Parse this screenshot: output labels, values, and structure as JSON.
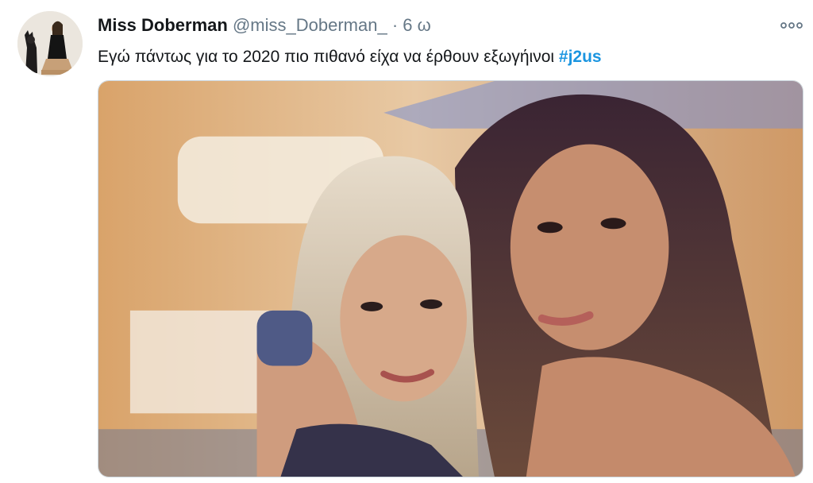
{
  "tweet": {
    "display_name": "Miss Doberman",
    "handle": "@miss_Doberman_",
    "separator": "·",
    "time": "6 ω",
    "text": "Εγώ πάντως για το 2020 πιο πιθανό είχα να έρθουν εξωγήινοι",
    "hashtag": "#j2us",
    "avatar_icon": "profile-avatar",
    "more_icon": "more-options-icon",
    "media_kind": "photo"
  },
  "colors": {
    "name": "#14171a",
    "secondary": "#657786",
    "hashtag": "#1b95e0",
    "border": "#ccd6dd"
  }
}
